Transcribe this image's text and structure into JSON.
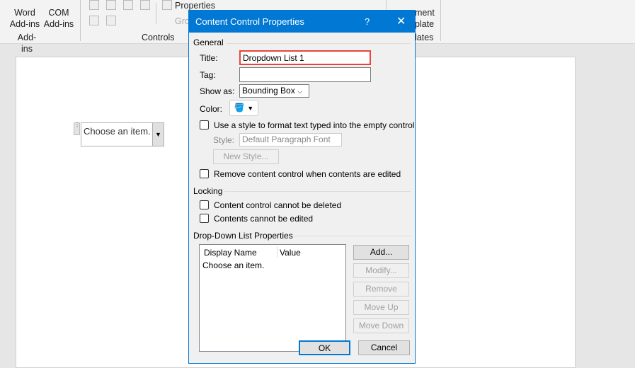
{
  "ribbon": {
    "word_addins": "Word Add-ins",
    "com_addins": "COM Add-ins",
    "group_addins": "Add-ins",
    "properties": "Properties",
    "group_label": "Gro",
    "group_controls": "Controls",
    "document_template": "ment\nplate",
    "group_templates": "lates"
  },
  "document": {
    "content_control_placeholder": "Choose an item."
  },
  "dialog": {
    "title": "Content Control Properties",
    "help": "?",
    "close": "✕",
    "general": "General",
    "title_label": "Title:",
    "title_value": "Dropdown List 1",
    "tag_label": "Tag:",
    "tag_value": "",
    "show_as_label": "Show as:",
    "show_as_value": "Bounding Box",
    "color_label": "Color:",
    "use_style_label": "Use a style to format text typed into the empty control",
    "style_label": "Style:",
    "style_value": "Default Paragraph Font",
    "new_style": "New Style...",
    "remove_label": "Remove content control when contents are edited",
    "locking": "Locking",
    "cannot_delete": "Content control cannot be deleted",
    "cannot_edit": "Contents cannot be edited",
    "dropdown_props": "Drop-Down List Properties",
    "col_display": "Display Name",
    "col_value": "Value",
    "items": [
      {
        "display": "Choose an item.",
        "value": ""
      }
    ],
    "add": "Add...",
    "modify": "Modify...",
    "remove": "Remove",
    "move_up": "Move Up",
    "move_down": "Move Down",
    "ok": "OK",
    "cancel": "Cancel"
  }
}
